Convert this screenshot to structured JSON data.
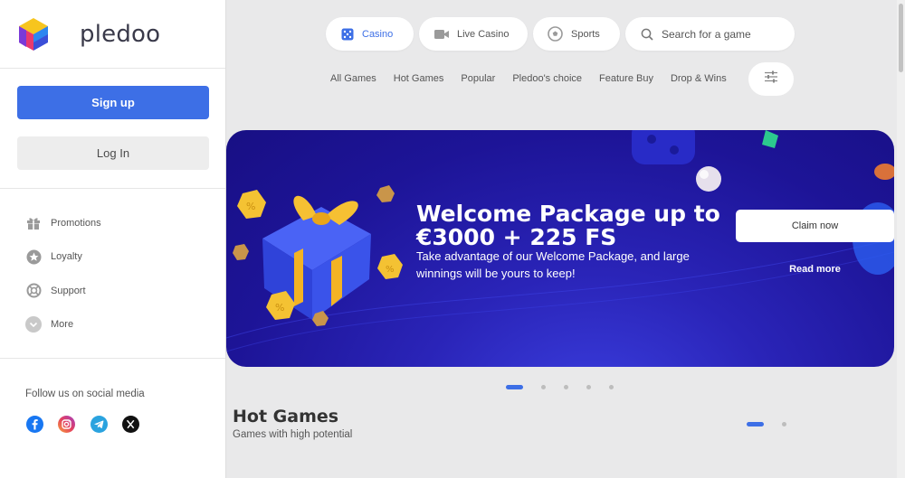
{
  "brand": {
    "name": "pledoo"
  },
  "auth": {
    "signup_label": "Sign up",
    "login_label": "Log In"
  },
  "sidebar": {
    "items": [
      {
        "label": "Promotions",
        "icon": "gift-icon"
      },
      {
        "label": "Loyalty",
        "icon": "star-icon"
      },
      {
        "label": "Support",
        "icon": "lifebuoy-icon"
      },
      {
        "label": "More",
        "icon": "chevron-down-icon"
      }
    ],
    "social_title": "Follow us on social media",
    "social": [
      "facebook-icon",
      "instagram-icon",
      "telegram-icon",
      "x-icon"
    ]
  },
  "nav": {
    "casino": "Casino",
    "live_casino": "Live Casino",
    "sports": "Sports",
    "search_placeholder": "Search for a game",
    "categories": [
      "All Games",
      "Hot Games",
      "Popular",
      "Pledoo's choice",
      "Feature Buy",
      "Drop & Wins"
    ]
  },
  "banner": {
    "title": "Welcome Package up to €3000 + 225 FS",
    "text": "Take advantage of our Welcome Package, and large winnings will be yours to keep!",
    "claim_label": "Claim now",
    "read_more_label": "Read more",
    "slides_total": 5,
    "active_slide": 1
  },
  "hot_games": {
    "title": "Hot Games",
    "subtitle": "Games with high potential",
    "pages_total": 2,
    "active_page": 1
  },
  "colors": {
    "accent": "#3d6fe6",
    "banner_bg": "#1d1497",
    "background": "#e9e9ea"
  }
}
